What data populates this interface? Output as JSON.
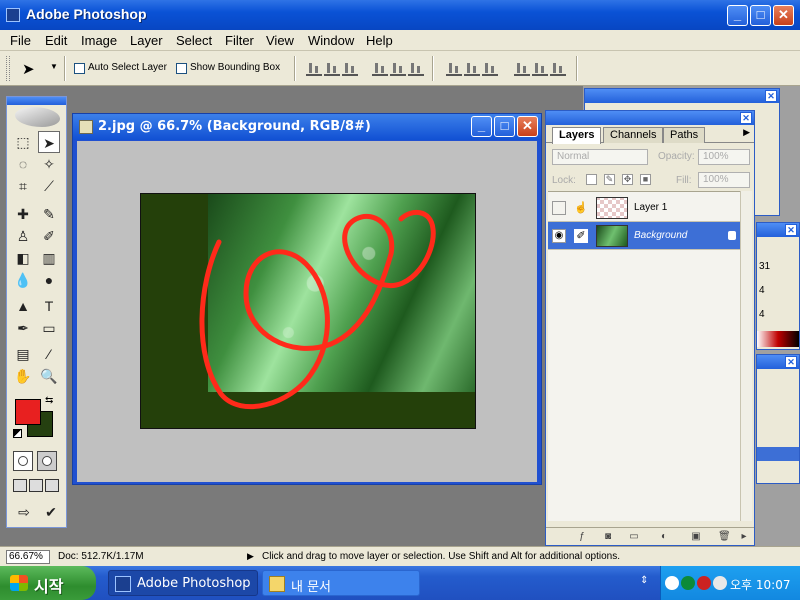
{
  "app": {
    "title": "Adobe Photoshop"
  },
  "menu": [
    "File",
    "Edit",
    "Image",
    "Layer",
    "Select",
    "Filter",
    "View",
    "Window",
    "Help"
  ],
  "options_bar": {
    "auto_select_label": "Auto Select Layer",
    "auto_select_checked": false,
    "bounding_box_label": "Show Bounding Box",
    "bounding_box_checked": false
  },
  "tool_colors": {
    "foreground": "#e82020",
    "background": "#254010"
  },
  "document": {
    "title": "2.jpg @ 66.7% (Background, RGB/8#)"
  },
  "layers_panel": {
    "tabs": [
      "Layers",
      "Channels",
      "Paths"
    ],
    "active_tab": "Layers",
    "blend_mode": "Normal",
    "opacity_label": "Opacity:",
    "opacity": "100%",
    "lock_label": "Lock:",
    "fill_label": "Fill:",
    "fill": "100%",
    "layers": [
      {
        "name": "Layer 1",
        "visible": false,
        "selected": false
      },
      {
        "name": "Background",
        "visible": true,
        "selected": true,
        "locked": true
      }
    ]
  },
  "status": {
    "zoom": "66.67%",
    "doc_size": "Doc: 512.7K/1.17M",
    "message": "Click and drag to move layer or selection.  Use Shift and Alt for additional options."
  },
  "side_panels": {
    "values": [
      "31",
      "4",
      "4"
    ]
  },
  "taskbar": {
    "start_label": "시작",
    "items": [
      {
        "label": "Adobe Photoshop",
        "active": true
      },
      {
        "label": "내 문서",
        "active": false
      }
    ],
    "clock": "오후 10:07"
  }
}
